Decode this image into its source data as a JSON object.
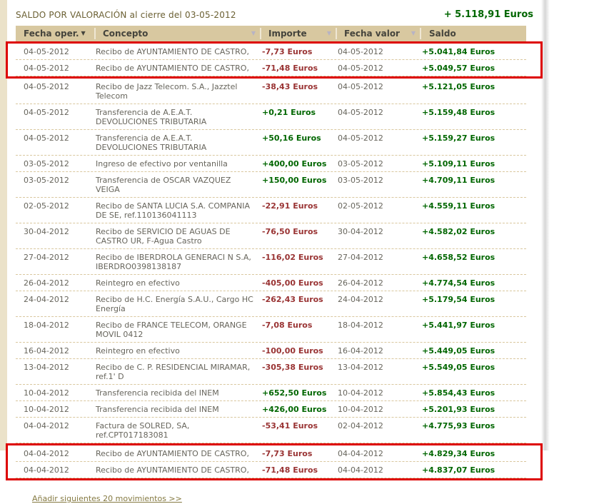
{
  "page": {
    "title": "SALDO POR VALORACIÓN al cierre del 03-05-2012",
    "total": "+ 5.118,91 Euros",
    "footer_link": "Añadir siguientes 20 movimientos >>"
  },
  "colors": {
    "header_bg": "#d8c8a0",
    "title_text": "#6b6033",
    "row_text": "#67655c",
    "positive": "#006600",
    "negative": "#993333",
    "highlight_border": "#dd0000",
    "link": "#857a42"
  },
  "table": {
    "columns": [
      {
        "label": "Fecha oper.",
        "sort": "active"
      },
      {
        "label": "Concepto",
        "sort": "inactive"
      },
      {
        "label": "Importe",
        "sort": "inactive"
      },
      {
        "label": "Fecha valor",
        "sort": "inactive"
      },
      {
        "label": "Saldo",
        "sort": "none"
      }
    ],
    "rows": [
      {
        "fecha_oper": "04-05-2012",
        "concepto": "Recibo de AYUNTAMIENTO DE CASTRO,",
        "importe": "-7,73 Euros",
        "sign": "neg",
        "fecha_valor": "04-05-2012",
        "saldo": "+5.041,84 Euros",
        "highlight": true
      },
      {
        "fecha_oper": "04-05-2012",
        "concepto": "Recibo de AYUNTAMIENTO DE CASTRO,",
        "importe": "-71,48 Euros",
        "sign": "neg",
        "fecha_valor": "04-05-2012",
        "saldo": "+5.049,57 Euros",
        "highlight": true
      },
      {
        "fecha_oper": "04-05-2012",
        "concepto": "Recibo de Jazz Telecom. S.A., Jazztel Telecom",
        "importe": "-38,43 Euros",
        "sign": "neg",
        "fecha_valor": "04-05-2012",
        "saldo": "+5.121,05 Euros",
        "highlight": false
      },
      {
        "fecha_oper": "04-05-2012",
        "concepto": "Transferencia de A.E.A.T. DEVOLUCIONES TRIBUTARIA",
        "importe": "+0,21 Euros",
        "sign": "pos",
        "fecha_valor": "04-05-2012",
        "saldo": "+5.159,48 Euros",
        "highlight": false
      },
      {
        "fecha_oper": "04-05-2012",
        "concepto": "Transferencia de A.E.A.T. DEVOLUCIONES TRIBUTARIA",
        "importe": "+50,16 Euros",
        "sign": "pos",
        "fecha_valor": "04-05-2012",
        "saldo": "+5.159,27 Euros",
        "highlight": false
      },
      {
        "fecha_oper": "03-05-2012",
        "concepto": "Ingreso de efectivo por ventanilla",
        "importe": "+400,00 Euros",
        "sign": "pos",
        "fecha_valor": "03-05-2012",
        "saldo": "+5.109,11 Euros",
        "highlight": false
      },
      {
        "fecha_oper": "03-05-2012",
        "concepto": "Transferencia de OSCAR VAZQUEZ VEIGA",
        "importe": "+150,00 Euros",
        "sign": "pos",
        "fecha_valor": "03-05-2012",
        "saldo": "+4.709,11 Euros",
        "highlight": false
      },
      {
        "fecha_oper": "02-05-2012",
        "concepto": "Recibo de SANTA LUCIA S.A. COMPANIA DE SE, ref.110136041113",
        "importe": "-22,91 Euros",
        "sign": "neg",
        "fecha_valor": "02-05-2012",
        "saldo": "+4.559,11 Euros",
        "highlight": false
      },
      {
        "fecha_oper": "30-04-2012",
        "concepto": "Recibo de SERVICIO DE AGUAS DE CASTRO UR, F-Agua Castro",
        "importe": "-76,50 Euros",
        "sign": "neg",
        "fecha_valor": "30-04-2012",
        "saldo": "+4.582,02 Euros",
        "highlight": false
      },
      {
        "fecha_oper": "27-04-2012",
        "concepto": "Recibo de IBERDROLA GENERACI N S.A, IBERDRO0398138187",
        "importe": "-116,02 Euros",
        "sign": "neg",
        "fecha_valor": "27-04-2012",
        "saldo": "+4.658,52 Euros",
        "highlight": false
      },
      {
        "fecha_oper": "26-04-2012",
        "concepto": "Reintegro en efectivo",
        "importe": "-405,00 Euros",
        "sign": "neg",
        "fecha_valor": "26-04-2012",
        "saldo": "+4.774,54 Euros",
        "highlight": false
      },
      {
        "fecha_oper": "24-04-2012",
        "concepto": "Recibo de H.C. Energía S.A.U., Cargo HC Energía",
        "importe": "-262,43 Euros",
        "sign": "neg",
        "fecha_valor": "24-04-2012",
        "saldo": "+5.179,54 Euros",
        "highlight": false
      },
      {
        "fecha_oper": "18-04-2012",
        "concepto": "Recibo de FRANCE TELECOM, ORANGE MOVIL 0412",
        "importe": "-7,08 Euros",
        "sign": "neg",
        "fecha_valor": "18-04-2012",
        "saldo": "+5.441,97 Euros",
        "highlight": false
      },
      {
        "fecha_oper": "16-04-2012",
        "concepto": "Reintegro en efectivo",
        "importe": "-100,00 Euros",
        "sign": "neg",
        "fecha_valor": "16-04-2012",
        "saldo": "+5.449,05 Euros",
        "highlight": false
      },
      {
        "fecha_oper": "13-04-2012",
        "concepto": "Recibo de C. P. RESIDENCIAL MIRAMAR, ref.1' D",
        "importe": "-305,38 Euros",
        "sign": "neg",
        "fecha_valor": "13-04-2012",
        "saldo": "+5.549,05 Euros",
        "highlight": false
      },
      {
        "fecha_oper": "10-04-2012",
        "concepto": "Transferencia recibida del INEM",
        "importe": "+652,50 Euros",
        "sign": "pos",
        "fecha_valor": "10-04-2012",
        "saldo": "+5.854,43 Euros",
        "highlight": false
      },
      {
        "fecha_oper": "10-04-2012",
        "concepto": "Transferencia recibida del INEM",
        "importe": "+426,00 Euros",
        "sign": "pos",
        "fecha_valor": "10-04-2012",
        "saldo": "+5.201,93 Euros",
        "highlight": false
      },
      {
        "fecha_oper": "04-04-2012",
        "concepto": "Factura de SOLRED, SA, ref.CPT017183081",
        "importe": "-53,41 Euros",
        "sign": "neg",
        "fecha_valor": "02-04-2012",
        "saldo": "+4.775,93 Euros",
        "highlight": false
      },
      {
        "fecha_oper": "04-04-2012",
        "concepto": "Recibo de AYUNTAMIENTO DE CASTRO,",
        "importe": "-7,73 Euros",
        "sign": "neg",
        "fecha_valor": "04-04-2012",
        "saldo": "+4.829,34 Euros",
        "highlight": true
      },
      {
        "fecha_oper": "04-04-2012",
        "concepto": "Recibo de AYUNTAMIENTO DE CASTRO,",
        "importe": "-71,48 Euros",
        "sign": "neg",
        "fecha_valor": "04-04-2012",
        "saldo": "+4.837,07 Euros",
        "highlight": true
      }
    ]
  }
}
